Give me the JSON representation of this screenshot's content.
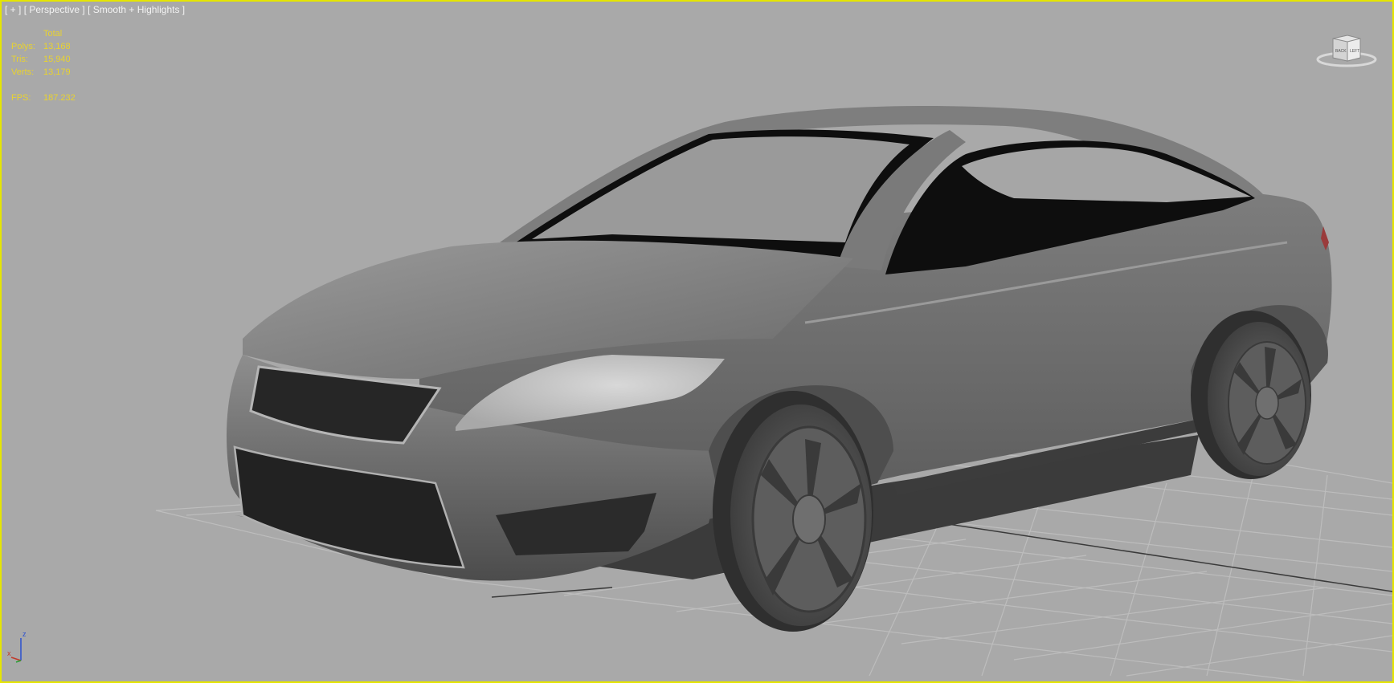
{
  "viewport": {
    "menu_plus": "[ + ]",
    "view_name": "[ Perspective ]",
    "shading_mode": "[ Smooth + Highlights ]",
    "border_color": "#e6e600"
  },
  "stats": {
    "header": "Total",
    "rows": [
      {
        "label": "Polys:",
        "value": "13,168"
      },
      {
        "label": "Tris:",
        "value": "15,940"
      },
      {
        "label": "Verts:",
        "value": "13,179"
      }
    ],
    "fps_label": "FPS:",
    "fps_value": "187.232",
    "color": "#e8d230"
  },
  "viewcube": {
    "left_face": "BACK",
    "right_face": "LEFT"
  },
  "axis_gizmo": {
    "z_label": "z",
    "x_label": "x"
  },
  "scene": {
    "object": "car-model",
    "grid": true
  }
}
